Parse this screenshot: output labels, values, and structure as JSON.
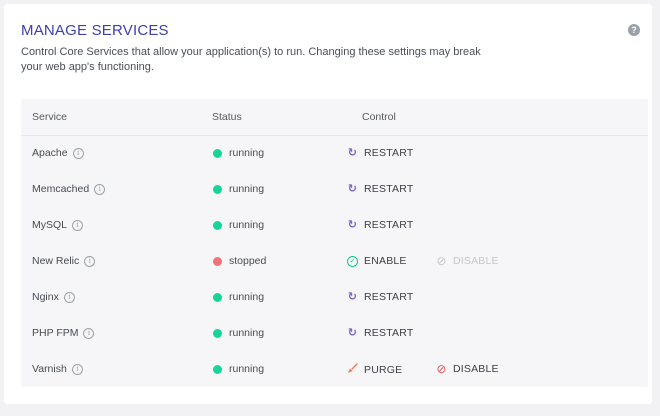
{
  "panel": {
    "title": "MANAGE SERVICES",
    "description": "Control Core Services that allow your application(s) to run. Changing these settings may break your web app's functioning.",
    "help_icon": "question-circle-icon"
  },
  "table": {
    "headers": {
      "service": "Service",
      "status": "Status",
      "control": "Control"
    },
    "rows": [
      {
        "service": "Apache",
        "status": "running",
        "actions": [
          {
            "label": "RESTART",
            "icon": "restart-icon",
            "enabled": true
          }
        ]
      },
      {
        "service": "Memcached",
        "status": "running",
        "actions": [
          {
            "label": "RESTART",
            "icon": "restart-icon",
            "enabled": true
          }
        ]
      },
      {
        "service": "MySQL",
        "status": "running",
        "actions": [
          {
            "label": "RESTART",
            "icon": "restart-icon",
            "enabled": true
          }
        ]
      },
      {
        "service": "New Relic",
        "status": "stopped",
        "actions": [
          {
            "label": "ENABLE",
            "icon": "check-circle-icon",
            "enabled": true
          },
          {
            "label": "DISABLE",
            "icon": "ban-icon",
            "enabled": false
          }
        ]
      },
      {
        "service": "Nginx",
        "status": "running",
        "actions": [
          {
            "label": "RESTART",
            "icon": "restart-icon",
            "enabled": true
          }
        ]
      },
      {
        "service": "PHP FPM",
        "status": "running",
        "actions": [
          {
            "label": "RESTART",
            "icon": "restart-icon",
            "enabled": true
          }
        ]
      },
      {
        "service": "Varnish",
        "status": "running",
        "actions": [
          {
            "label": "PURGE",
            "icon": "broom-icon",
            "enabled": true
          },
          {
            "label": "DISABLE",
            "icon": "ban-icon",
            "enabled": true
          }
        ]
      }
    ]
  },
  "colors": {
    "title": "#3f3fa8",
    "running": "#17d49a",
    "stopped": "#f07474",
    "restart_icon": "#7c5fd3",
    "enable_icon": "#17c48a",
    "purge_icon": "#f07a4a",
    "disable_icon": "#e25454",
    "disabled_text": "#c4c6cb"
  }
}
